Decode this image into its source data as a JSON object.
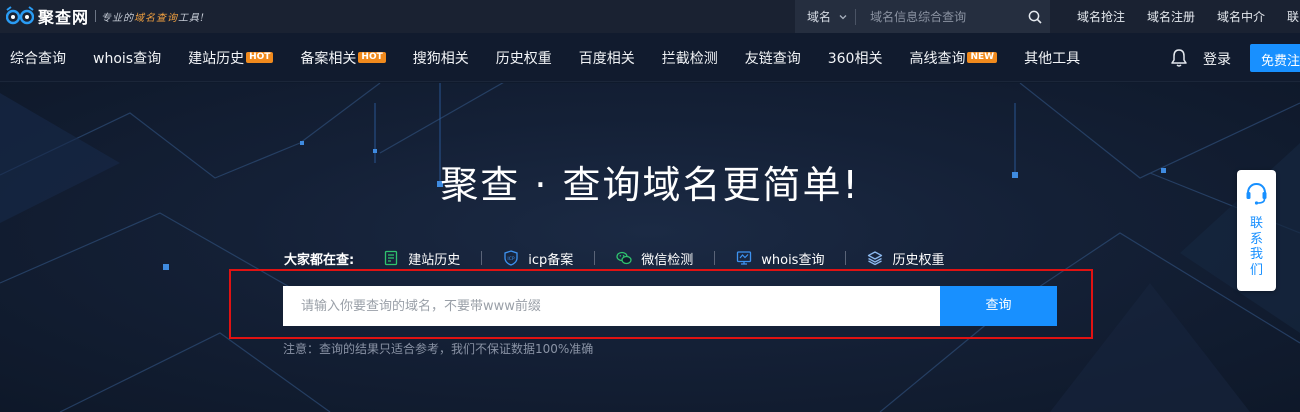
{
  "topbar": {
    "logo_text": "聚查网",
    "slogan_pre": "专业的",
    "slogan_hl": "域名查询",
    "slogan_post": "工具!",
    "search_type": "域名",
    "search_placeholder": "域名信息综合查询",
    "links": [
      "域名抢注",
      "域名注册",
      "域名中介",
      "联系我们"
    ]
  },
  "nav": {
    "items": [
      {
        "label": "综合查询",
        "badge": ""
      },
      {
        "label": "whois查询",
        "badge": ""
      },
      {
        "label": "建站历史",
        "badge": "HOT"
      },
      {
        "label": "备案相关",
        "badge": "HOT"
      },
      {
        "label": "搜狗相关",
        "badge": ""
      },
      {
        "label": "历史权重",
        "badge": ""
      },
      {
        "label": "百度相关",
        "badge": ""
      },
      {
        "label": "拦截检测",
        "badge": ""
      },
      {
        "label": "友链查询",
        "badge": ""
      },
      {
        "label": "360相关",
        "badge": ""
      },
      {
        "label": "高线查询",
        "badge": "NEW"
      },
      {
        "label": "其他工具",
        "badge": ""
      }
    ],
    "login": "登录",
    "register": "免费注册"
  },
  "hero": {
    "title": "聚查 · 查询域名更简单!",
    "hot_label": "大家都在查:",
    "hot_items": [
      {
        "label": "建站历史",
        "icon": "history-doc-icon"
      },
      {
        "label": "icp备案",
        "icon": "icp-shield-icon"
      },
      {
        "label": "微信检测",
        "icon": "wechat-icon"
      },
      {
        "label": "whois查询",
        "icon": "whois-monitor-icon"
      },
      {
        "label": "历史权重",
        "icon": "layers-icon"
      }
    ],
    "input_placeholder": "请输入你要查询的域名，不要带www前缀",
    "button": "查询",
    "notice": "注意：查询的结果只适合参考，我们不保证数据100%准确"
  },
  "contact": {
    "label": "联系我们",
    "icon": "customer-service-icon"
  },
  "colors": {
    "accent": "#1890ff",
    "badge": "#f08a1d",
    "highlight": "#e01212",
    "topbar_bg": "#1a2232",
    "hero_bg": "#142036"
  }
}
